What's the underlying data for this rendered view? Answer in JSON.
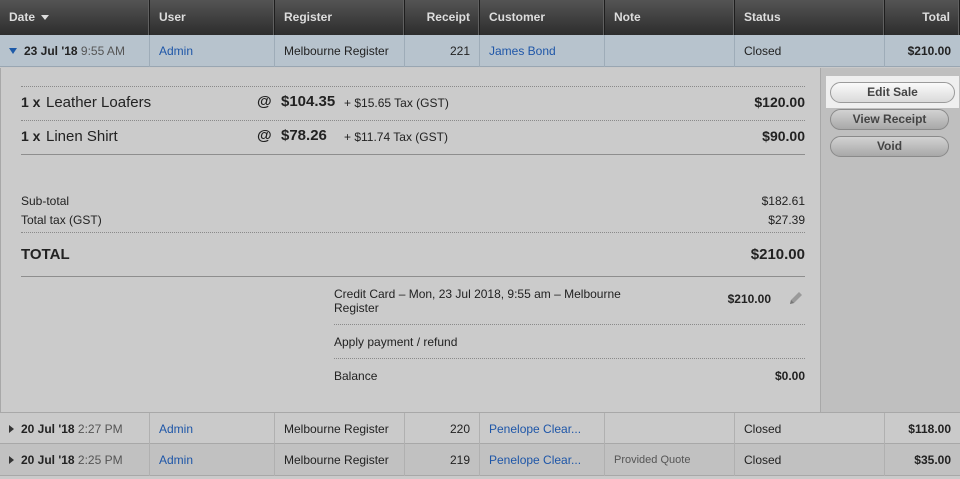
{
  "header": {
    "date": "Date",
    "user": "User",
    "register": "Register",
    "receipt": "Receipt",
    "customer": "Customer",
    "note": "Note",
    "status": "Status",
    "total": "Total"
  },
  "selected_sale": {
    "date": "23 Jul '18",
    "time": "9:55 AM",
    "user": "Admin",
    "register": "Melbourne Register",
    "receipt": "221",
    "customer": "James Bond",
    "note": "",
    "status": "Closed",
    "total": "$210.00"
  },
  "line_items": [
    {
      "qty": "1 x",
      "name": "Leather Loafers",
      "at": "@",
      "price": "$104.35",
      "tax": "+ $15.65 Tax (GST)",
      "amount": "$120.00"
    },
    {
      "qty": "1 x",
      "name": "Linen Shirt",
      "at": "@",
      "price": "$78.26",
      "tax": "+ $11.74 Tax (GST)",
      "amount": "$90.00"
    }
  ],
  "summary": {
    "subtotal_label": "Sub-total",
    "subtotal": "$182.61",
    "tax_label": "Total tax (GST)",
    "tax": "$27.39",
    "total_label": "TOTAL",
    "total": "$210.00"
  },
  "payments": {
    "payment_label": "Credit Card – Mon, 23 Jul 2018, 9:55 am – Melbourne Register",
    "payment_amount": "$210.00",
    "apply_label": "Apply payment / refund",
    "balance_label": "Balance",
    "balance": "$0.00"
  },
  "actions": {
    "edit": "Edit Sale",
    "view": "View Receipt",
    "void": "Void"
  },
  "rows": [
    {
      "date": "20 Jul '18",
      "time": "2:27 PM",
      "user": "Admin",
      "register": "Melbourne Register",
      "receipt": "220",
      "customer": "Penelope Clear...",
      "note": "",
      "status": "Closed",
      "total": "$118.00"
    },
    {
      "date": "20 Jul '18",
      "time": "2:25 PM",
      "user": "Admin",
      "register": "Melbourne Register",
      "receipt": "219",
      "customer": "Penelope Clear...",
      "note": "Provided Quote",
      "status": "Closed",
      "total": "$35.00"
    }
  ],
  "colors": {
    "header": "#3a3a3a",
    "selected_row": "#b7c3cd",
    "link": "#1e56a8"
  }
}
